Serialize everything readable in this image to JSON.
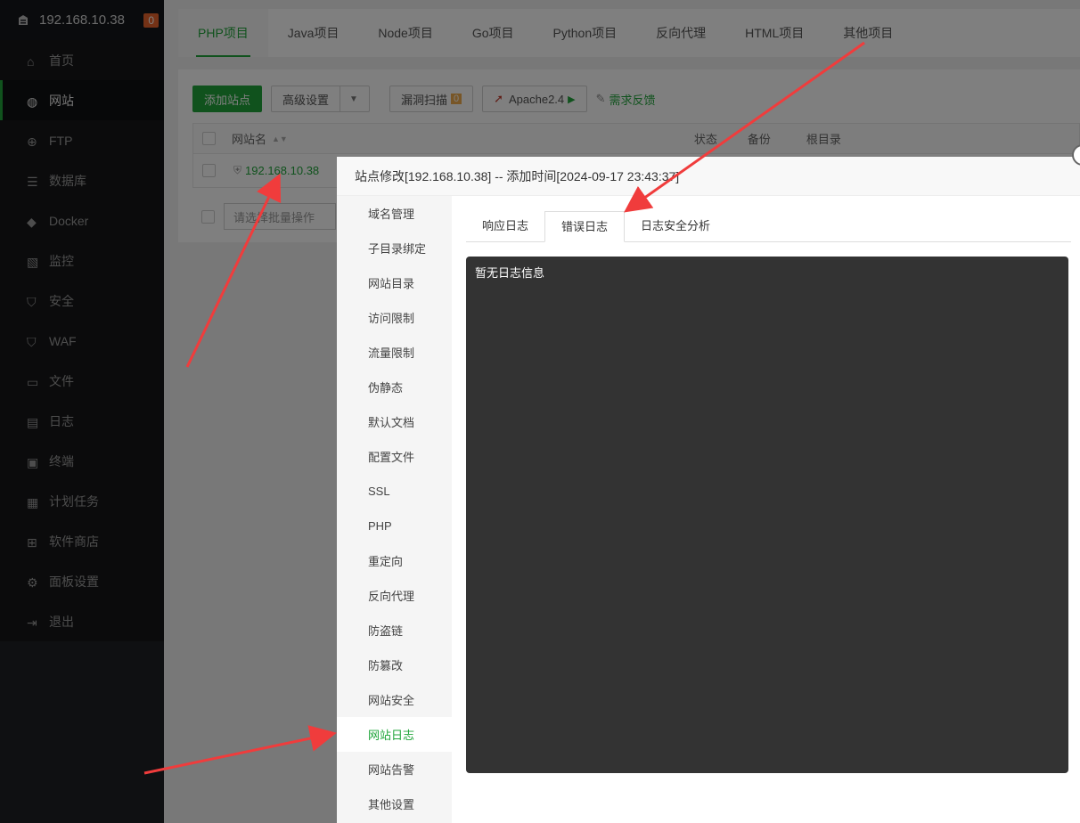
{
  "sidebar": {
    "host": "192.168.10.38",
    "badge": "0",
    "items": [
      {
        "label": "首页",
        "icon": "home-icon"
      },
      {
        "label": "网站",
        "icon": "globe-icon",
        "active": true
      },
      {
        "label": "FTP",
        "icon": "ftp-icon"
      },
      {
        "label": "数据库",
        "icon": "database-icon"
      },
      {
        "label": "Docker",
        "icon": "docker-icon"
      },
      {
        "label": "监控",
        "icon": "monitor-icon"
      },
      {
        "label": "安全",
        "icon": "shield-icon"
      },
      {
        "label": "WAF",
        "icon": "waf-icon"
      },
      {
        "label": "文件",
        "icon": "folder-icon"
      },
      {
        "label": "日志",
        "icon": "log-icon"
      },
      {
        "label": "终端",
        "icon": "terminal-icon"
      },
      {
        "label": "计划任务",
        "icon": "calendar-icon"
      },
      {
        "label": "软件商店",
        "icon": "grid-icon"
      },
      {
        "label": "面板设置",
        "icon": "gear-icon"
      },
      {
        "label": "退出",
        "icon": "logout-icon"
      }
    ]
  },
  "project_tabs": [
    "PHP项目",
    "Java项目",
    "Node项目",
    "Go项目",
    "Python项目",
    "反向代理",
    "HTML项目",
    "其他项目"
  ],
  "toolbar": {
    "add_site": "添加站点",
    "advanced": "高级设置",
    "scan": "漏洞扫描",
    "scan_count": "0",
    "apache": "Apache2.4",
    "feedback": "需求反馈"
  },
  "table": {
    "col_name": "网站名",
    "col_status": "状态",
    "col_backup": "备份",
    "col_root": "根目录",
    "rows": [
      {
        "name": "192.168.10.38"
      }
    ]
  },
  "batch": {
    "placeholder": "请选择批量操作"
  },
  "modal": {
    "title": "站点修改[192.168.10.38] -- 添加时间[2024-09-17 23:43:37]",
    "menu": [
      "域名管理",
      "子目录绑定",
      "网站目录",
      "访问限制",
      "流量限制",
      "伪静态",
      "默认文档",
      "配置文件",
      "SSL",
      "PHP",
      "重定向",
      "反向代理",
      "防盗链",
      "防篡改",
      "网站安全",
      "网站日志",
      "网站告警",
      "其他设置"
    ],
    "active_menu": "网站日志",
    "log_tabs": [
      "响应日志",
      "错误日志",
      "日志安全分析"
    ],
    "active_log_tab": "错误日志",
    "log_content": "暂无日志信息"
  },
  "colors": {
    "accent": "#20a53a",
    "badge": "#e8652d",
    "arrow": "#f03c3c"
  }
}
